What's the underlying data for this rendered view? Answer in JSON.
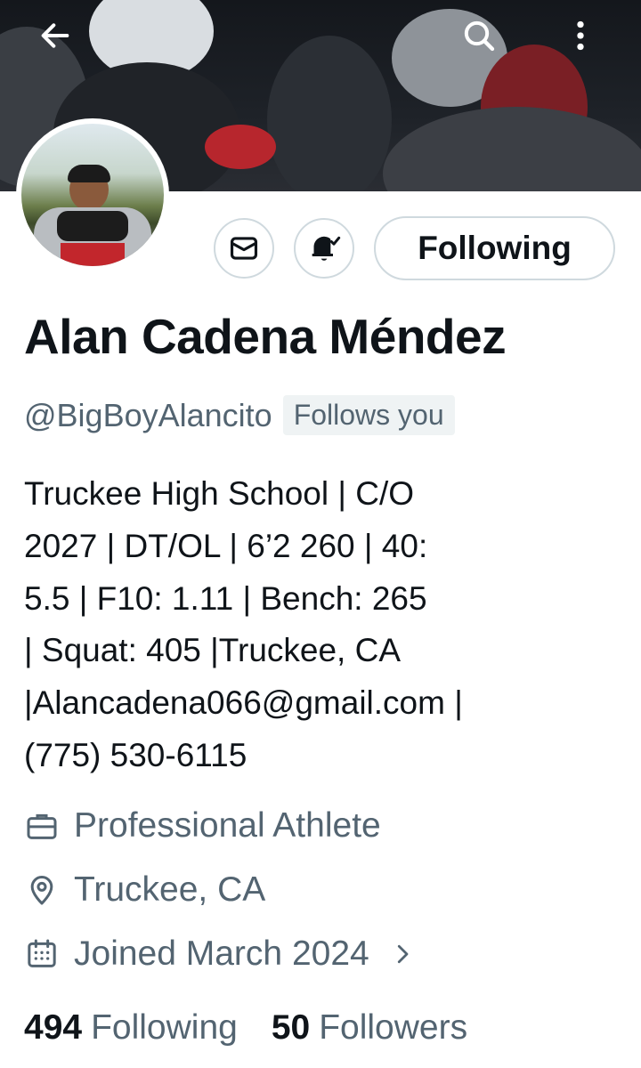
{
  "header": {
    "back_icon": "arrow-left-icon",
    "search_icon": "search-icon",
    "more_icon": "more-vertical-icon"
  },
  "profile": {
    "name": "Alan Cadena Méndez",
    "handle": "@BigBoyAlancito",
    "follows_you": "Follows you",
    "bio": "Truckee High School | C/O\n2027 | DT/OL | 6’2 260 | 40:\n5.5 | F10: 1.11 | Bench: 265\n| Squat: 405 |Truckee, CA\n|Alancadena066@gmail.com |\n(775) 530-6115",
    "profession": "Professional Athlete",
    "location": "Truckee, CA",
    "joined": "Joined March 2024"
  },
  "actions": {
    "message_icon": "envelope-icon",
    "notify_icon": "bell-check-icon",
    "following_label": "Following"
  },
  "stats": {
    "following_count": "494",
    "following_label": "Following",
    "followers_count": "50",
    "followers_label": "Followers"
  },
  "colors": {
    "text": "#0f1419",
    "secondary": "#536471",
    "border": "#cfd9de",
    "badge_bg": "#eff3f4"
  }
}
